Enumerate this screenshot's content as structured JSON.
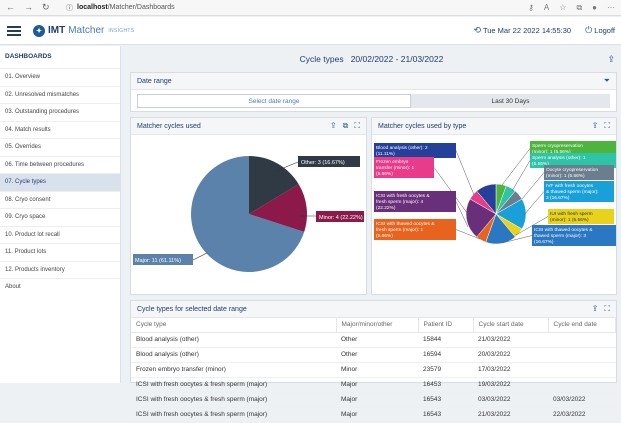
{
  "browser": {
    "url_host": "localhost",
    "url_path": "/Matcher/Dashboards"
  },
  "app": {
    "brand": "IMT",
    "product": "Matcher",
    "product_suffix": "INSIGHTS",
    "datetime": "Tue Mar 22 2022 14:55:30",
    "logoff": "Logoff"
  },
  "sidebar": {
    "title": "DASHBOARDS",
    "items": [
      {
        "label": "01. Overview"
      },
      {
        "label": "02. Unresolved mismatches"
      },
      {
        "label": "03. Outstanding procedures"
      },
      {
        "label": "04. Match results"
      },
      {
        "label": "05. Overrides"
      },
      {
        "label": "06. Time between procedures"
      },
      {
        "label": "07. Cycle types"
      },
      {
        "label": "08. Cryo consent"
      },
      {
        "label": "09. Cryo space"
      },
      {
        "label": "10. Product lot recall"
      },
      {
        "label": "11. Product lots"
      },
      {
        "label": "12. Products inventory"
      },
      {
        "label": "About"
      }
    ]
  },
  "page": {
    "title": "Cycle types",
    "range": "20/02/2022 - 21/03/2022"
  },
  "date_range": {
    "title": "Date range",
    "select_label": "Select date range",
    "last30_label": "Last 30 Days"
  },
  "chart1": {
    "title": "Matcher cycles used",
    "labels": {
      "other": "Other: 3 (16.67%)",
      "minor": "Minor: 4 (22.22%)",
      "major": "Major: 11 (61.11%)"
    },
    "colors": {
      "major": "#5b82ab",
      "minor": "#8b1a4a",
      "other": "#2f3a45"
    }
  },
  "chart2": {
    "title": "Matcher cycles used by type",
    "labels": {
      "blood": "Blood analysis (other): 2 (11.11%)",
      "frozen": "Frozen embryo transfer (minor): 1 (5.56%)",
      "icsi_fresh": "ICSI with fresh oocytes & fresh sperm (major): 4 (22.22%)",
      "icsi_thawed_fresh": "ICSI with thawed oocytes & fresh sperm (major): 1 (5.56%)",
      "sperm_cryo": "Sperm cryopreservation (minor): 1 (5.56%)",
      "sperm_an": "Sperm analysis (other): 1 (5.56%)",
      "oocyte_cryo": "Oocyte cryopreservation (minor): 1 (5.56%)",
      "ivf": "IVF with fresh oocytes & thawed sperm (major): 3 (16.67%)",
      "iui": "IUI with fresh sperm (minor): 1 (5.56%)",
      "icsi_thawed_thawed": "ICSI with thawed oocytes & thawed sperm (major): 3 (16.67%)"
    }
  },
  "table": {
    "title": "Cycle types for selected date range",
    "columns": [
      "Cycle type",
      "Major/minor/other",
      "Patient ID",
      "Cycle start date",
      "Cycle end date"
    ],
    "rows": [
      [
        "Blood analysis (other)",
        "Other",
        "15844",
        "21/03/2022",
        ""
      ],
      [
        "Blood analysis (other)",
        "Other",
        "16594",
        "20/03/2022",
        ""
      ],
      [
        "Frozen embryo transfer (minor)",
        "Minor",
        "23579",
        "17/03/2022",
        ""
      ],
      [
        "ICSI with fresh oocytes & fresh sperm (major)",
        "Major",
        "16453",
        "19/03/2022",
        ""
      ],
      [
        "ICSI with fresh oocytes & fresh sperm (major)",
        "Major",
        "16543",
        "03/03/2022",
        "03/03/2022"
      ],
      [
        "ICSI with fresh oocytes & fresh sperm (major)",
        "Major",
        "16543",
        "21/03/2022",
        "22/03/2022"
      ]
    ]
  }
}
